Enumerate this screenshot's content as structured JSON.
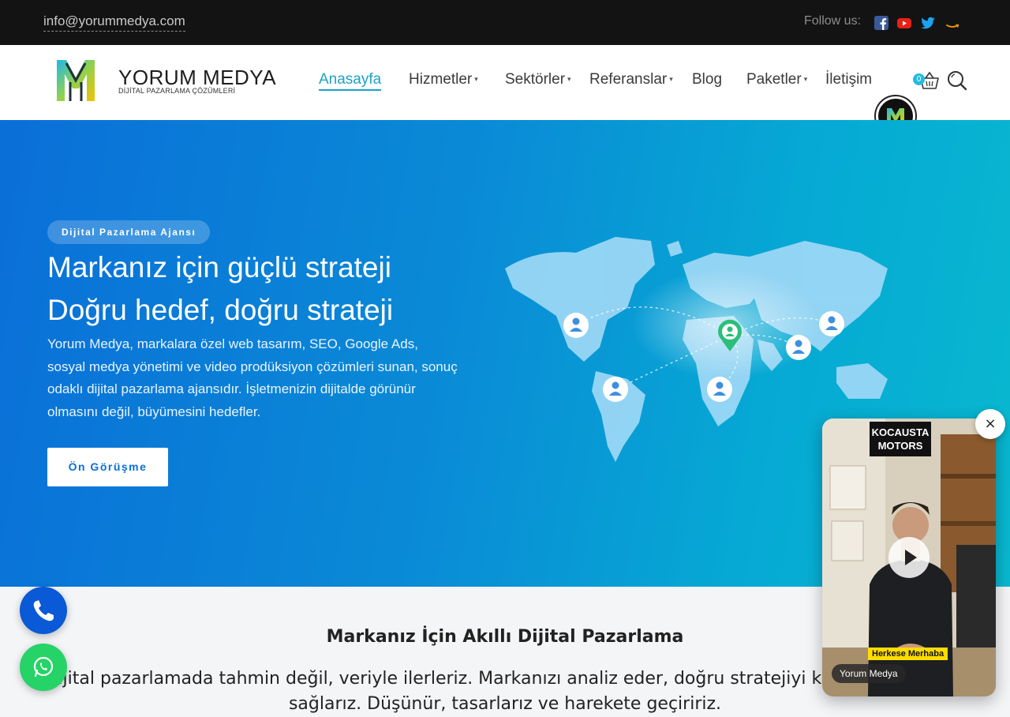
{
  "topbar": {
    "email": "info@yorummedya.com",
    "follow_label": "Follow us:",
    "social": [
      "facebook-icon",
      "youtube-icon",
      "twitter-icon",
      "amazon-icon"
    ]
  },
  "brand": {
    "name": "YORUM MEDYA",
    "tagline": "DİJİTAL PAZARLAMA ÇÖZÜMLERİ"
  },
  "nav": {
    "items": [
      {
        "label": "Anasayfa",
        "active": true,
        "dropdown": false
      },
      {
        "label": "Hizmetler",
        "dropdown": true
      },
      {
        "label": "Sektörler",
        "dropdown": true
      },
      {
        "label": "Referanslar",
        "dropdown": true
      },
      {
        "label": "Blog",
        "dropdown": false
      },
      {
        "label": "Paketler",
        "dropdown": true
      },
      {
        "label": "İletişim",
        "dropdown": false
      }
    ],
    "cart_count": "0",
    "caret": "▾"
  },
  "hero": {
    "badge": "Dijital Pazarlama Ajansı",
    "title_line1": "Markanız için güçlü strateji",
    "title_line2": "Doğru hedef, doğru strateji",
    "description": "Yorum Medya, markalara özel web tasarım, SEO, Google Ads, sosyal medya yönetimi ve video prodüksiyon çözümleri sunan, sonuç odaklı dijital pazarlama ajansıdır. İşletmenizin dijitalde görünür olmasını değil, büyümesini hedefler.",
    "cta_label": "Ön Görüşme"
  },
  "section": {
    "title": "Markanız İçin Akıllı Dijital Pazarlama",
    "text": "Dijital pazarlamada tahmin değil, veriyle ilerleriz. Markanızı analiz eder, doğru stratejiyi kurgular, büyüme sağlarız. Düşünür, tasarlarız ve harekete geçiririz."
  },
  "video_popup": {
    "close_label": "×",
    "sign_line1": "KOCAUSTA",
    "sign_line2": "MOTORS",
    "overlay_tag": "Herkese Merhaba",
    "channel_label": "Yorum Medya"
  },
  "colors": {
    "accent": "#1aa3c8",
    "hero_start": "#0a6fd8",
    "hero_end": "#08b8cf",
    "phone_fab": "#0a59d6",
    "whatsapp_fab": "#25d366"
  }
}
